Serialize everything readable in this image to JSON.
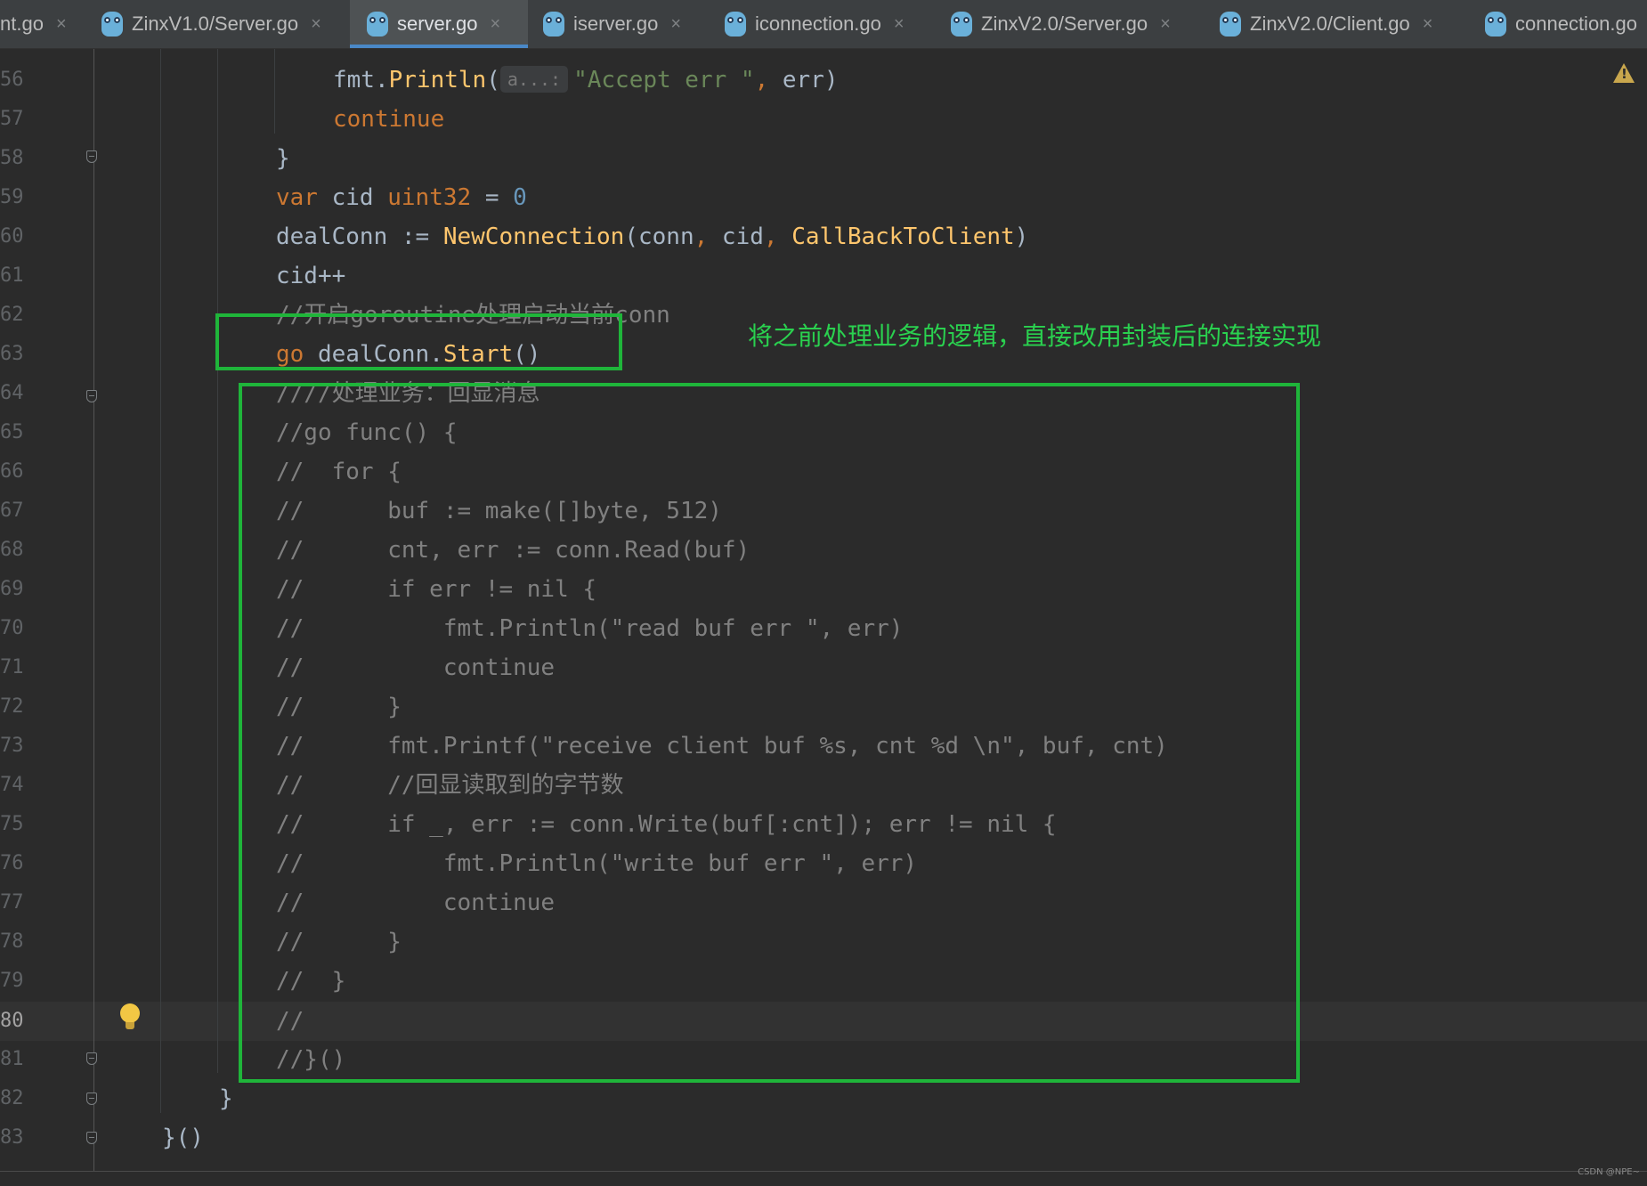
{
  "tabs": [
    {
      "label": "nt.go",
      "active": false
    },
    {
      "label": "ZinxV1.0/Server.go",
      "active": false
    },
    {
      "label": "server.go",
      "active": true
    },
    {
      "label": "iserver.go",
      "active": false
    },
    {
      "label": "iconnection.go",
      "active": false
    },
    {
      "label": "ZinxV2.0/Server.go",
      "active": false
    },
    {
      "label": "ZinxV2.0/Client.go",
      "active": false
    },
    {
      "label": "connection.go",
      "active": false
    }
  ],
  "tab_close_glyph": "×",
  "editor": {
    "current_line": "80",
    "hint_text": "a...:",
    "lines": [
      {
        "n": "56",
        "text": "fmt.Println(\"Accept err \", err)"
      },
      {
        "n": "57",
        "text": "continue"
      },
      {
        "n": "58",
        "text": "}"
      },
      {
        "n": "59",
        "text": "var cid uint32 = 0"
      },
      {
        "n": "60",
        "text": "dealConn := NewConnection(conn, cid, CallBackToClient)"
      },
      {
        "n": "61",
        "text": "cid++"
      },
      {
        "n": "62",
        "text": "//开启goroutine处理启动当前conn"
      },
      {
        "n": "63",
        "text": "go dealConn.Start()"
      },
      {
        "n": "64",
        "text": "////处理业务：回显消息"
      },
      {
        "n": "65",
        "text": "//go func() {"
      },
      {
        "n": "66",
        "text": "//  for {"
      },
      {
        "n": "67",
        "text": "//      buf := make([]byte, 512)"
      },
      {
        "n": "68",
        "text": "//      cnt, err := conn.Read(buf)"
      },
      {
        "n": "69",
        "text": "//      if err != nil {"
      },
      {
        "n": "70",
        "text": "//          fmt.Println(\"read buf err \", err)"
      },
      {
        "n": "71",
        "text": "//          continue"
      },
      {
        "n": "72",
        "text": "//      }"
      },
      {
        "n": "73",
        "text": "//      fmt.Printf(\"receive client buf %s, cnt %d \\n\", buf, cnt)"
      },
      {
        "n": "74",
        "text": "//      //回显读取到的字节数"
      },
      {
        "n": "75",
        "text": "//      if _, err := conn.Write(buf[:cnt]); err != nil {"
      },
      {
        "n": "76",
        "text": "//          fmt.Println(\"write buf err \", err)"
      },
      {
        "n": "77",
        "text": "//          continue"
      },
      {
        "n": "78",
        "text": "//      }"
      },
      {
        "n": "79",
        "text": "//  }"
      },
      {
        "n": "80",
        "text": "//"
      },
      {
        "n": "81",
        "text": "//}()"
      },
      {
        "n": "82",
        "text": "}"
      },
      {
        "n": "83",
        "text": "}()"
      }
    ]
  },
  "annotation": {
    "text": "将之前处理业务的逻辑，直接改用封装后的连接实现",
    "color": "#1fb53a"
  },
  "watermark": "CSDN @NPE~",
  "colors": {
    "background": "#2b2b2b",
    "keyword": "#cc7832",
    "number": "#6897bb",
    "string": "#6a8759",
    "function": "#ffc66d",
    "comment": "#808080",
    "text": "#a9b7c6",
    "tab_accent": "#4a88c7"
  }
}
